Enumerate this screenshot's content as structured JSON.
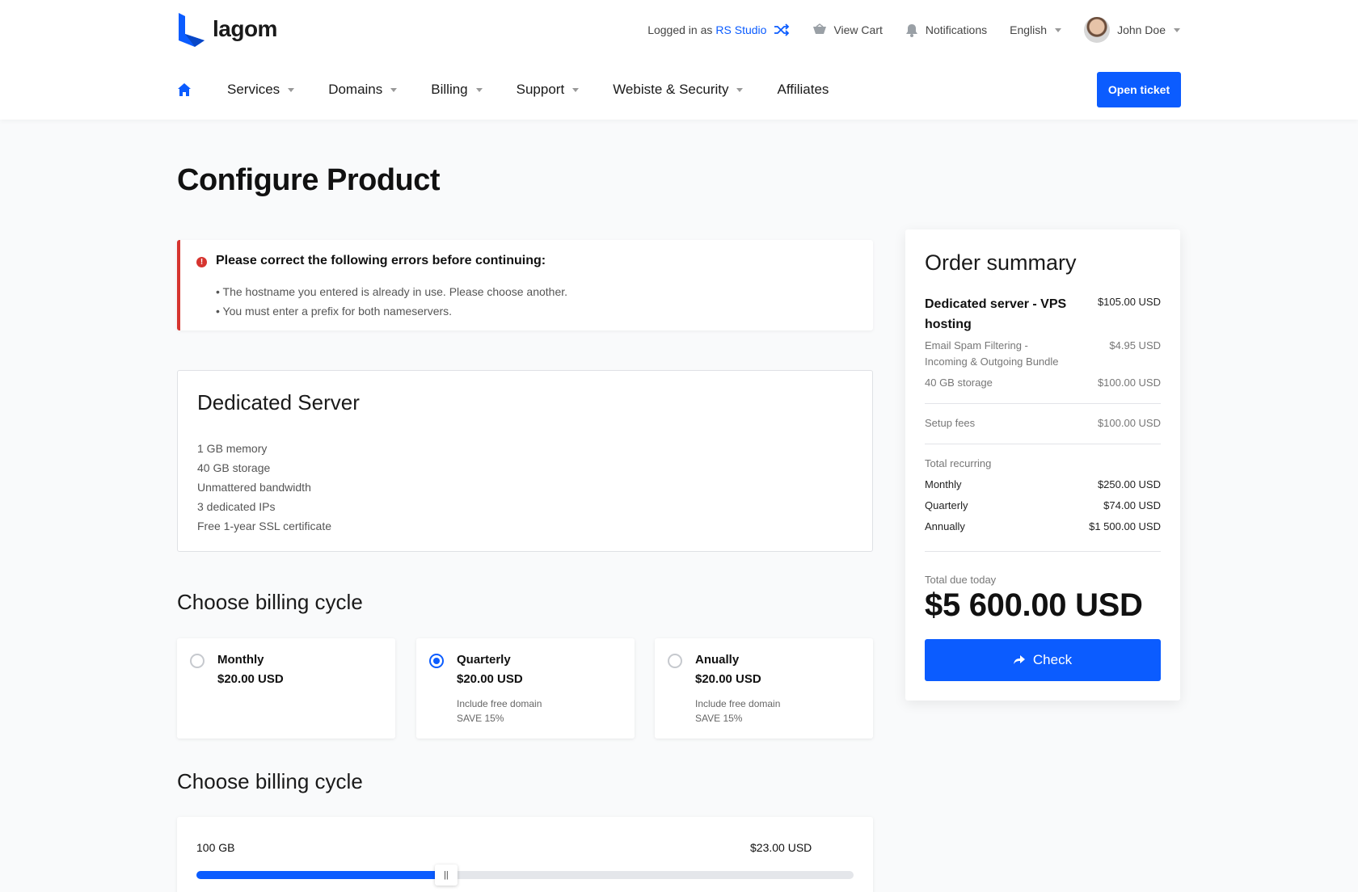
{
  "brand": {
    "name": "lagom",
    "accent": "#0b5cff",
    "error": "#d6342f"
  },
  "topbar": {
    "logged_in_prefix": "Logged in as",
    "logged_in_user": "RS Studio",
    "view_cart": "View Cart",
    "notifications": "Notifications",
    "language": "English",
    "user_name": "John Doe"
  },
  "nav": {
    "items": [
      {
        "label": "Services"
      },
      {
        "label": "Domains"
      },
      {
        "label": "Billing"
      },
      {
        "label": "Support"
      },
      {
        "label": "Webiste & Security"
      },
      {
        "label": "Affiliates"
      }
    ],
    "open_ticket": "Open ticket"
  },
  "page": {
    "title": "Configure Product"
  },
  "alert": {
    "title": "Please correct the following errors before continuing:",
    "errors": [
      "• The hostname you entered is already in use. Please choose another.",
      "• You must enter a prefix for both nameservers."
    ]
  },
  "product": {
    "title": "Dedicated Server",
    "features": [
      "1 GB memory",
      "40 GB storage",
      "Unmattered bandwidth",
      "3 dedicated IPs",
      "Free 1-year SSL certificate"
    ]
  },
  "billing": {
    "title": "Choose billing cycle",
    "options": [
      {
        "name": "Monthly",
        "price": "$20.00 USD",
        "note1": "",
        "note2": "",
        "selected": false
      },
      {
        "name": "Quarterly",
        "price": "$20.00 USD",
        "note1": "Include free domain",
        "note2": "SAVE 15%",
        "selected": true
      },
      {
        "name": "Anually",
        "price": "$20.00 USD",
        "note1": "Include free domain",
        "note2": "SAVE 15%",
        "selected": false
      }
    ]
  },
  "storage": {
    "title": "Choose billing cycle",
    "label": "100 GB",
    "price": "$23.00 USD",
    "level_fraction": 0.38
  },
  "summary": {
    "title": "Order summary",
    "product_name": "Dedicated server - VPS hosting",
    "product_price": "$105.00 USD",
    "addons": [
      {
        "label": "Email Spam Filtering - Incoming & Outgoing Bundle",
        "value": "$4.95 USD"
      },
      {
        "label": "40 GB storage",
        "value": "$100.00 USD"
      }
    ],
    "setup_label": "Setup fees",
    "setup_value": "$100.00 USD",
    "recurring_label": "Total recurring",
    "recurring": [
      {
        "label": "Monthly",
        "value": "$250.00 USD"
      },
      {
        "label": "Quarterly",
        "value": "$74.00 USD"
      },
      {
        "label": "Annually",
        "value": "$1 500.00 USD"
      }
    ],
    "due_label": "Total due today",
    "due_amount": "$5 600.00 USD",
    "check_label": "Check"
  }
}
